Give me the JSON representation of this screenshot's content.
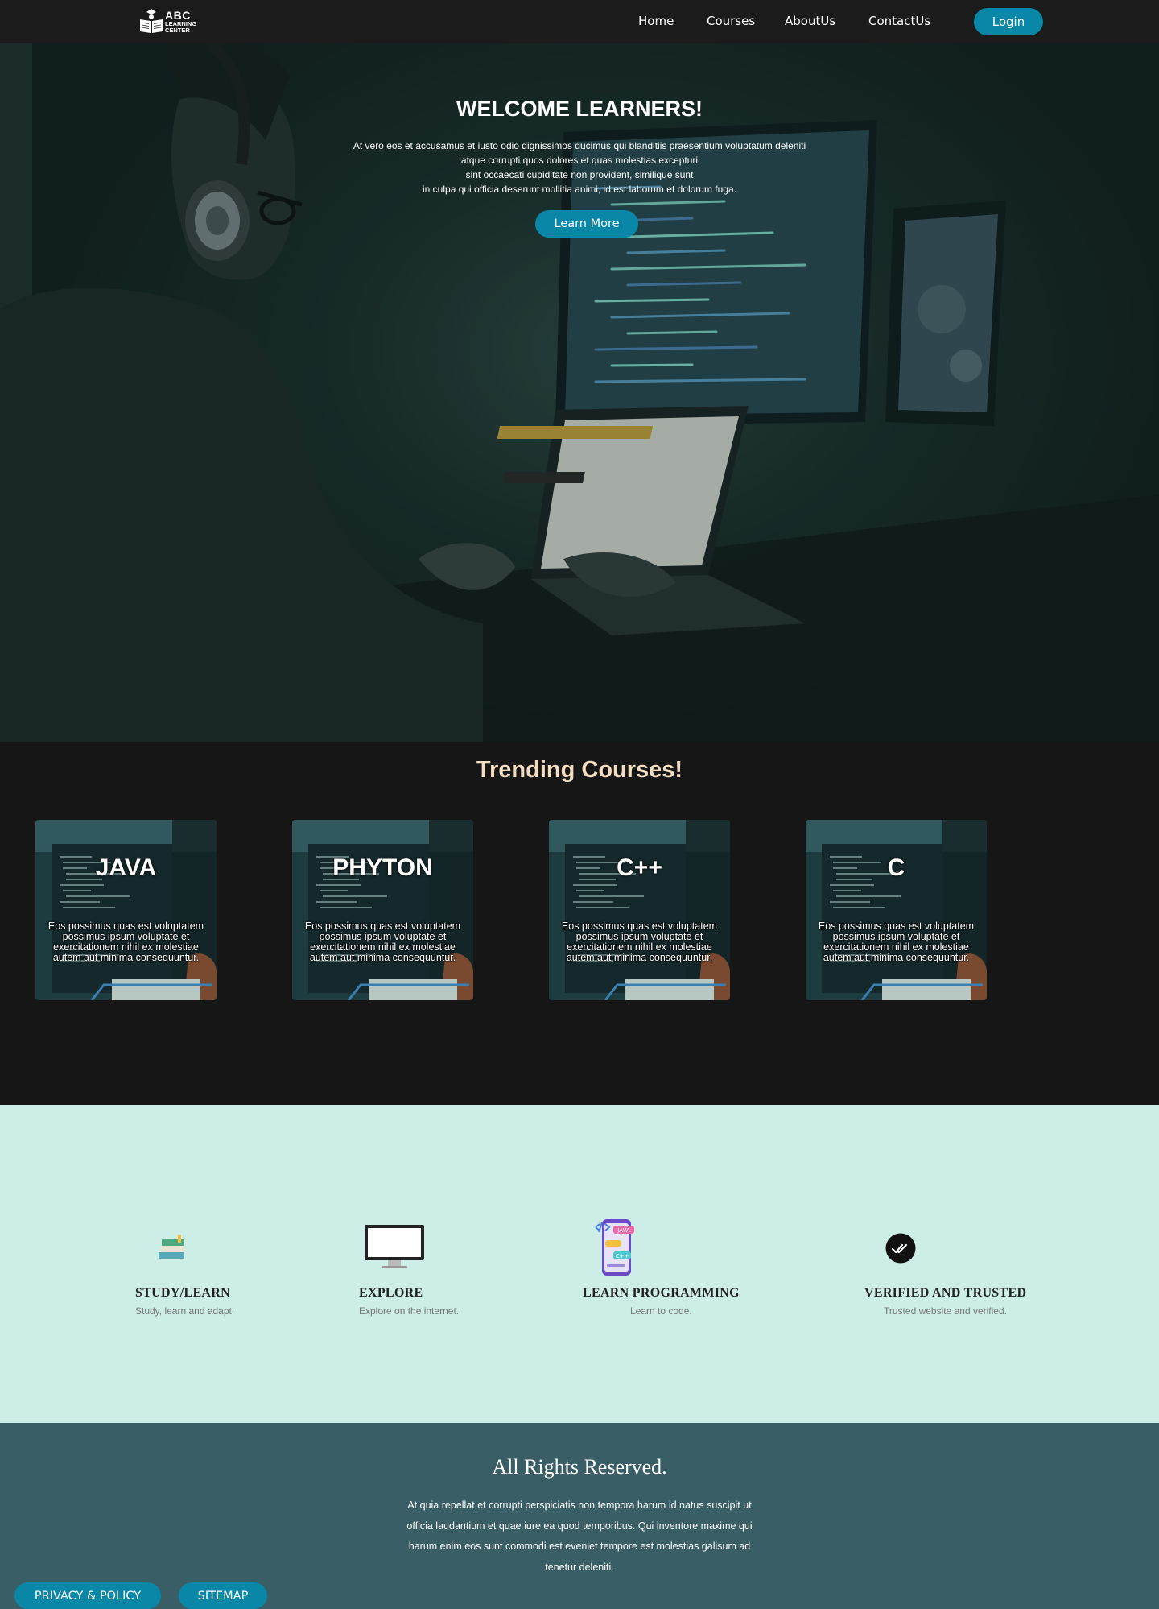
{
  "colors": {
    "accent": "#0a86a6",
    "nav_bg": "#1b1b1b",
    "dark_bg": "#161616",
    "trending_title": "#f3dcc0",
    "features_bg": "#cdeee6",
    "footer_bg": "#3a5e66"
  },
  "logo": {
    "name": "ABC",
    "sub_line1": "LEARNING",
    "sub_line2": "CENTER",
    "icon": "book-logo-icon"
  },
  "nav": {
    "links": [
      "Home",
      "Courses",
      "AboutUs",
      "ContactUs"
    ],
    "login_label": "Login"
  },
  "hero": {
    "title": "WELCOME LEARNERS!",
    "lines": [
      "At vero eos et accusamus et iusto odio dignissimos ducimus qui blanditiis praesentium voluptatum deleniti",
      "atque corrupti quos dolores et quas molestias excepturi",
      "sint occaecati cupiditate non provident, similique sunt",
      "in culpa qui officia deserunt mollitia animi, id est laborum et dolorum fuga."
    ],
    "button_label": "Learn More"
  },
  "trending": {
    "title": "Trending Courses!",
    "courses": [
      {
        "title": "JAVA",
        "text": "Eos possimus quas est voluptatem possimus ipsum voluptate et exercitationem nihil ex molestiae autem aut minima consequuntur."
      },
      {
        "title": "PHYTON",
        "text": "Eos possimus quas est voluptatem possimus ipsum voluptate et exercitationem nihil ex molestiae autem aut minima consequuntur."
      },
      {
        "title": "C++",
        "text": "Eos possimus quas est voluptatem possimus ipsum voluptate et exercitationem nihil ex molestiae autem aut minima consequuntur."
      },
      {
        "title": "C",
        "text": "Eos possimus quas est voluptatem possimus ipsum voluptate et exercitationem nihil ex molestiae autem aut minima consequuntur."
      }
    ]
  },
  "features": [
    {
      "icon": "books-icon",
      "title": "STUDY/LEARN",
      "text": "Study, learn and adapt."
    },
    {
      "icon": "monitor-icon",
      "title": "EXPLORE",
      "text": "Explore on the internet."
    },
    {
      "icon": "phone-code-icon",
      "title": "LEARN PROGRAMMING",
      "text": "Learn to code."
    },
    {
      "icon": "double-check-icon",
      "title": "VERIFIED AND TRUSTED",
      "text": "Trusted website and verified."
    }
  ],
  "footer": {
    "title": "All Rights Reserved.",
    "text": "At quia repellat et corrupti perspiciatis non tempora harum id natus suscipit ut officia laudantium et quae iure ea quod temporibus. Qui inventore maxime qui harum enim eos sunt commodi est eveniet tempore est molestias galisum ad tenetur deleniti.",
    "privacy_label": "PRIVACY & POLICY",
    "sitemap_label": "SITEMAP"
  }
}
